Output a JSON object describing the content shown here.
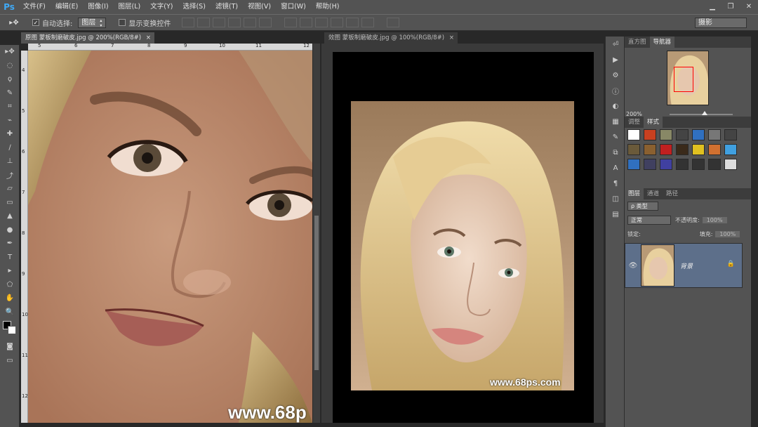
{
  "app": {
    "logo": "Ps"
  },
  "menu": [
    "文件(F)",
    "编辑(E)",
    "图像(I)",
    "图层(L)",
    "文字(Y)",
    "选择(S)",
    "滤镜(T)",
    "视图(V)",
    "窗口(W)",
    "帮助(H)"
  ],
  "window_controls": {
    "minimize": "▁",
    "restore": "❐",
    "close": "✕"
  },
  "options": {
    "auto_select_label": "自动选择:",
    "auto_select_value": "图层",
    "show_transform_label": "显示变换控件",
    "workspace": "摄影"
  },
  "documents": {
    "doc1": {
      "tab": "原图 蒙板制磨破皮.jpg @ 200%(RGB/8#)",
      "close": "×",
      "ruler_h": [
        "5",
        "6",
        "7",
        "8",
        "9",
        "10",
        "11",
        "12"
      ],
      "ruler_v": [
        "4",
        "5",
        "6",
        "7",
        "8",
        "9",
        "10",
        "11",
        "12"
      ],
      "watermark": "www.68p"
    },
    "doc2": {
      "tab": "效图 蒙板制磨破皮.jpg @ 100%(RGB/8#)",
      "close": "×",
      "watermark": "www.68ps.com"
    }
  },
  "panels": {
    "top_tabs": [
      "直方图",
      "导航器"
    ],
    "zoom": "200%",
    "mid_tabs": [
      "调整",
      "样式"
    ],
    "layers_tabs": [
      "图层",
      "通道",
      "路径"
    ],
    "filter": "ρ 类型",
    "blend_mode": "正常",
    "opacity_label": "不透明度:",
    "opacity_value": "100%",
    "lock_label": "锁定:",
    "fill_label": "填充:",
    "fill_value": "100%",
    "layer_name": "背景",
    "eye": "👁",
    "lock_icon": "🔒"
  },
  "colors": {
    "accent": "#3fa9f5",
    "layer_selected": "#5d6f8a"
  },
  "styles_swatches": [
    "#ffffff",
    "#c84020",
    "#888866",
    "#444444",
    "#3070c0",
    "#777777",
    "#444444",
    "#6a5a3a",
    "#8a6030",
    "#c02020",
    "#3a2a1a",
    "#e0c020",
    "#d07030",
    "#40a0e0",
    "#3070c0",
    "#404060",
    "#4040a0",
    "#333333",
    "#333333",
    "#333333",
    "#dddddd"
  ]
}
